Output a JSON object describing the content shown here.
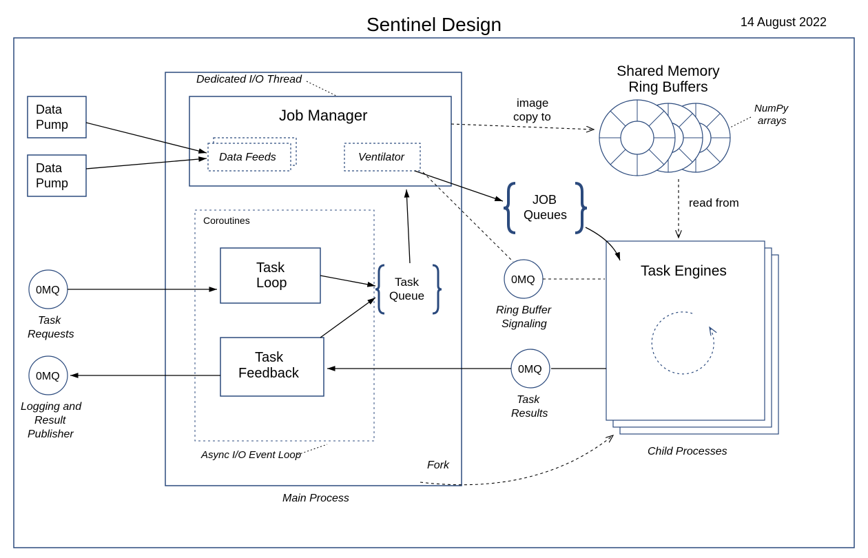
{
  "title": "Sentinel Design",
  "date": "14 August 2022",
  "labels": {
    "data_pump": "Data\nPump",
    "job_manager": "Job Manager",
    "dedicated_io_thread": "Dedicated I/O Thread",
    "data_feeds": "Data Feeds",
    "ventilator": "Ventilator",
    "coroutines": "Coroutines",
    "task_loop": "Task\nLoop",
    "task_feedback": "Task\nFeedback",
    "task_queue": "Task\nQueue",
    "async_io_loop": "Async I/O Event Loop",
    "main_process": "Main Process",
    "fork": "Fork",
    "zeromq": "0MQ",
    "task_requests": "Task\nRequests",
    "logging_publisher": "Logging and\nResult\nPublisher",
    "image_copy_to": "image\ncopy to",
    "shared_memory_ring_buffers": "Shared Memory\nRing Buffers",
    "numpy_arrays": "NumPy\narrays",
    "job_queues": "JOB\nQueues",
    "ring_buffer_signaling": "Ring Buffer\nSignaling",
    "task_results": "Task\nResults",
    "read_from": "read from",
    "task_engines": "Task Engines",
    "child_processes": "Child Processes"
  },
  "colors": {
    "stroke": "#2b4a7d",
    "light_stroke": "#6e8fb5"
  }
}
